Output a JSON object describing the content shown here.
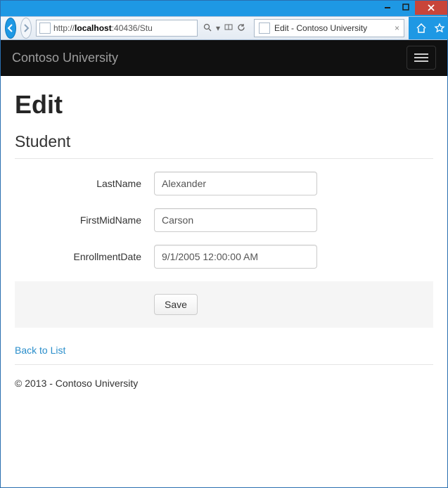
{
  "browser": {
    "url_prefix": "http://",
    "url_host": "localhost",
    "url_rest": ":40436/Stu",
    "tab_title": "Edit - Contoso University"
  },
  "navbar": {
    "brand": "Contoso University"
  },
  "page": {
    "heading": "Edit",
    "subheading": "Student",
    "fields": {
      "lastname_label": "LastName",
      "lastname_value": "Alexander",
      "firstmid_label": "FirstMidName",
      "firstmid_value": "Carson",
      "enroll_label": "EnrollmentDate",
      "enroll_value": "9/1/2005 12:00:00 AM"
    },
    "save_label": "Save",
    "back_link": "Back to List"
  },
  "footer_text": "© 2013 - Contoso University"
}
